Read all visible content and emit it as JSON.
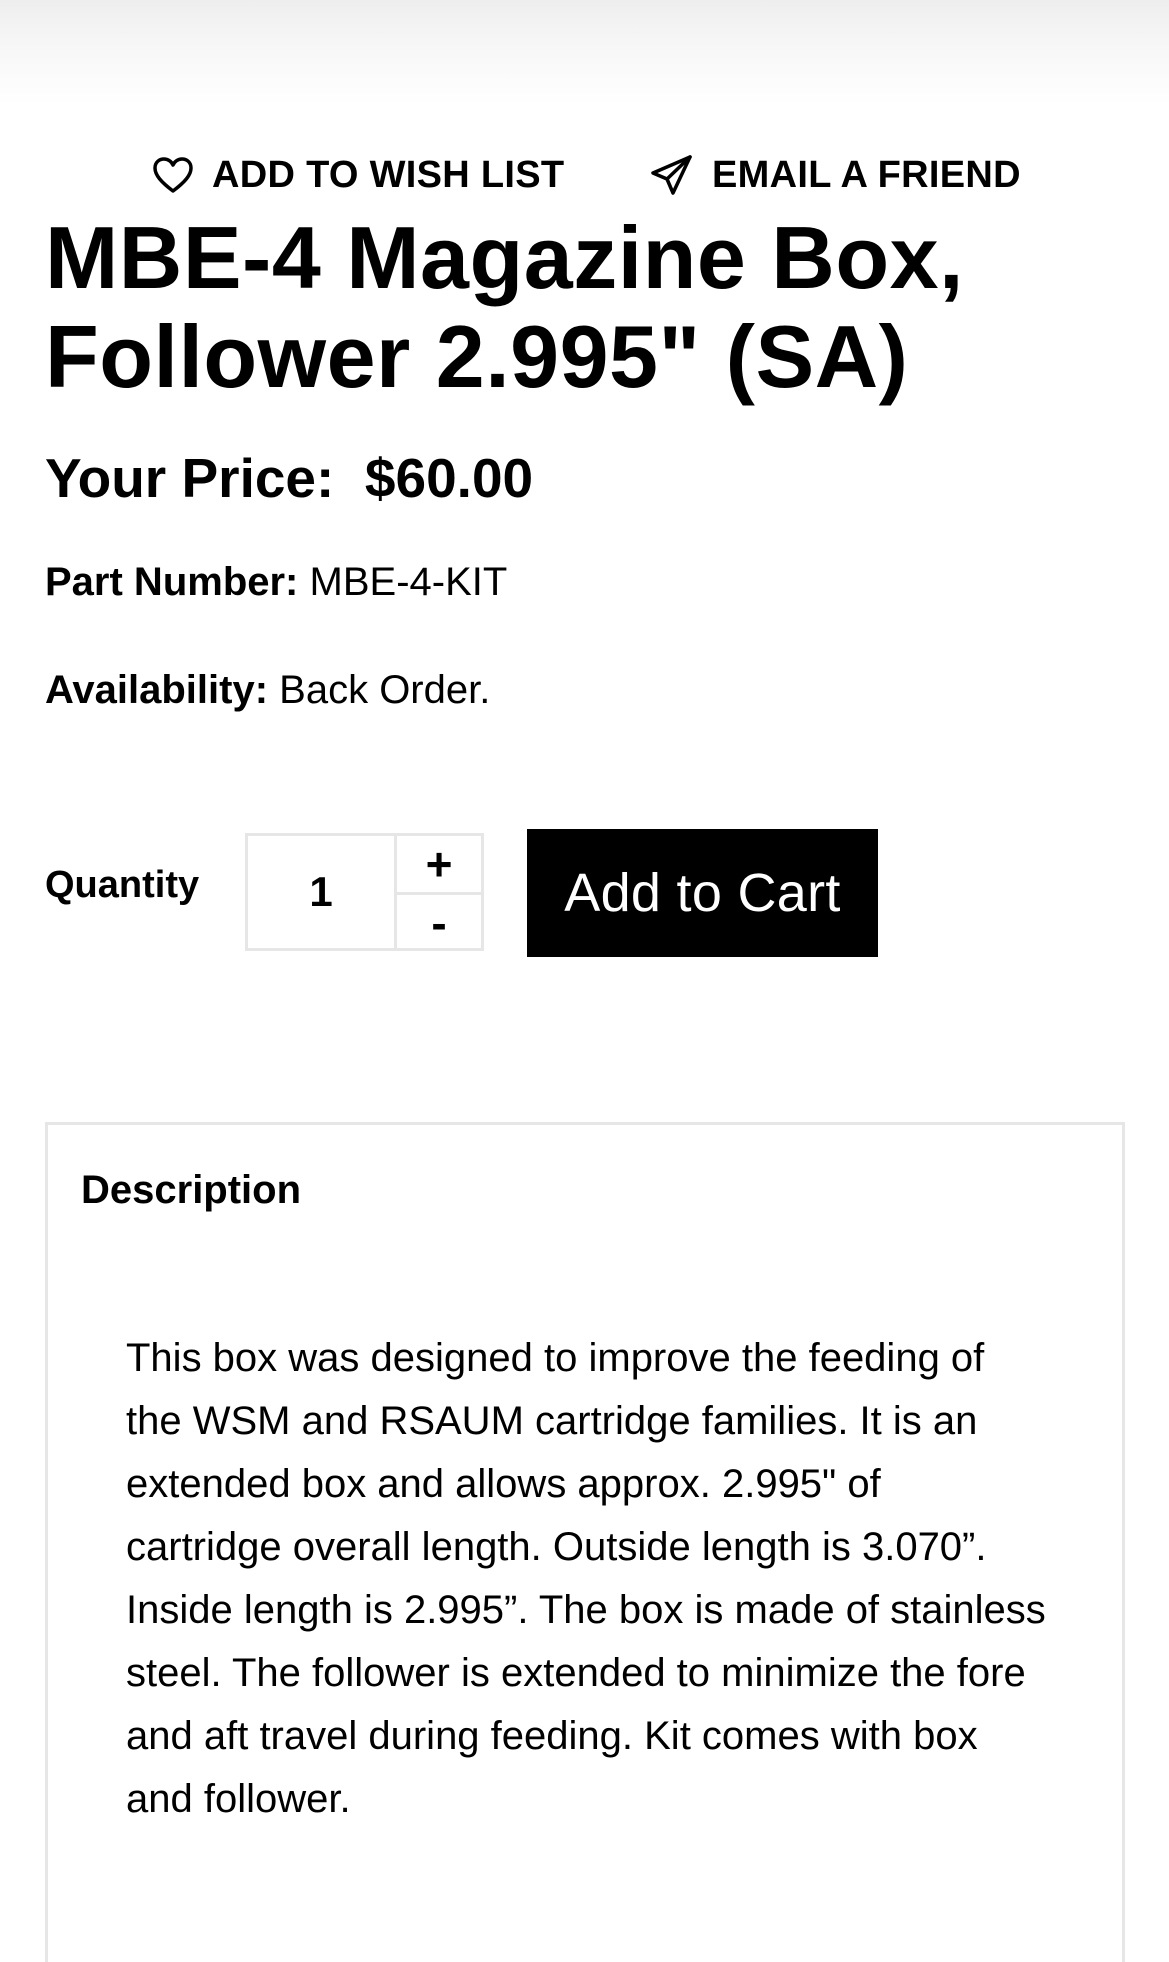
{
  "actions": {
    "wish_list": "ADD TO WISH LIST",
    "email_friend": "EMAIL A FRIEND"
  },
  "product": {
    "title": "MBE-4 Magazine Box, Follower 2.995\" (SA)",
    "price_label": "Your Price:",
    "price_value": "$60.00",
    "part_number_label": "Part Number:",
    "part_number_value": "MBE-4-KIT",
    "availability_label": "Availability:",
    "availability_value": "Back Order."
  },
  "purchase": {
    "quantity_label": "Quantity",
    "quantity_value": "1",
    "increment_label": "+",
    "decrement_label": "-",
    "add_to_cart_label": "Add to Cart"
  },
  "description": {
    "heading": "Description",
    "body": "This box was designed to improve the feeding of the WSM and RSAUM cartridge families. It is an extended box and allows approx. 2.995\" of cartridge overall length. Outside length is 3.070”. Inside length is 2.995”. The box is made of stainless steel. The follower is extended to minimize the fore and aft travel during feeding. Kit comes with box and follower."
  },
  "icons": {
    "wish_list": "heart-outline-icon",
    "email_friend": "paper-plane-icon"
  },
  "colors": {
    "text": "#000000",
    "button_bg": "#000000",
    "button_text": "#ffffff",
    "border": "#e6e6e6"
  }
}
